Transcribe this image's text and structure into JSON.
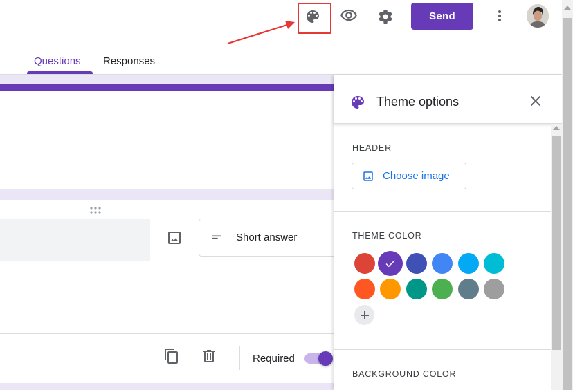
{
  "toolbar": {
    "send_label": "Send",
    "icons": [
      "palette-icon",
      "eye-icon",
      "gear-icon",
      "more-vert-icon"
    ],
    "highlight_color": "#e53935"
  },
  "tabs": [
    {
      "label": "Questions",
      "active": true
    },
    {
      "label": "Responses",
      "active": false
    }
  ],
  "question": {
    "type_label": "Short answer",
    "required_label": "Required",
    "required_on": true
  },
  "theme_panel": {
    "title": "Theme options",
    "header_section_label": "HEADER",
    "choose_image_label": "Choose image",
    "theme_color_label": "THEME COLOR",
    "background_color_label": "BACKGROUND COLOR",
    "theme_colors": [
      {
        "name": "red",
        "hex": "#db4437",
        "selected": false
      },
      {
        "name": "deep-purple",
        "hex": "#673ab7",
        "selected": true
      },
      {
        "name": "indigo",
        "hex": "#3f51b5",
        "selected": false
      },
      {
        "name": "blue",
        "hex": "#4285f4",
        "selected": false
      },
      {
        "name": "light-blue",
        "hex": "#03a9f4",
        "selected": false
      },
      {
        "name": "cyan",
        "hex": "#00bcd4",
        "selected": false
      },
      {
        "name": "deep-orange",
        "hex": "#ff5722",
        "selected": false
      },
      {
        "name": "orange",
        "hex": "#ff9800",
        "selected": false
      },
      {
        "name": "teal",
        "hex": "#009688",
        "selected": false
      },
      {
        "name": "green",
        "hex": "#4caf50",
        "selected": false
      },
      {
        "name": "blue-grey",
        "hex": "#607d8b",
        "selected": false
      },
      {
        "name": "grey",
        "hex": "#9e9e9e",
        "selected": false
      }
    ]
  },
  "colors": {
    "accent": "#673ab7",
    "link": "#1a73e8",
    "canvas": "#ebe6f5"
  }
}
